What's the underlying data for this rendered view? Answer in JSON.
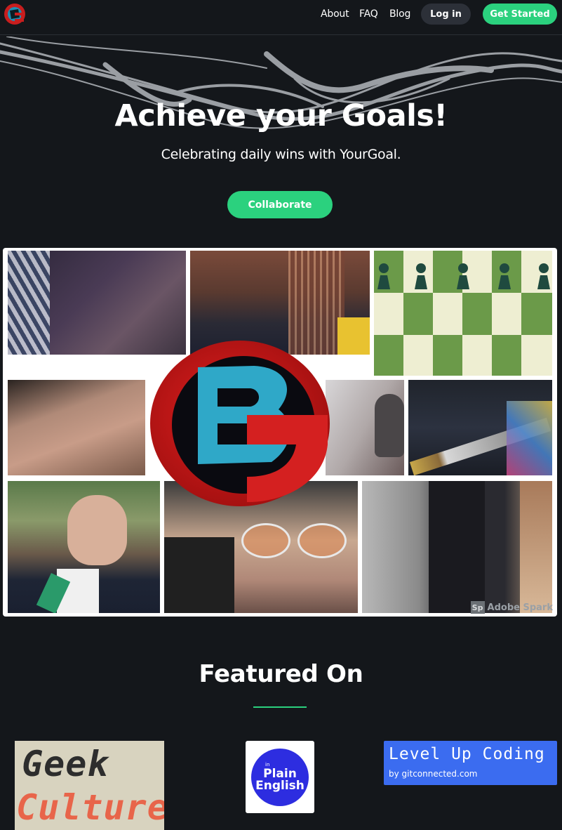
{
  "nav": {
    "links": [
      "About",
      "FAQ",
      "Blog"
    ],
    "login_label": "Log in",
    "get_started_label": "Get Started"
  },
  "hero": {
    "title": "Achieve your Goals!",
    "subtitle": "Celebrating daily wins with YourGoal.",
    "cta_label": "Collaborate"
  },
  "collage": {
    "watermark_badge": "Sp",
    "watermark_text": "Adobe Spark"
  },
  "featured": {
    "title": "Featured On",
    "publications": {
      "geek_culture": {
        "line1": "Geek",
        "line2": "Culture"
      },
      "plain_english": {
        "small": "in",
        "line1": "Plain",
        "line2": "English"
      },
      "level_up": {
        "title": "Level Up Coding",
        "subtitle": "by gitconnected.com"
      }
    }
  },
  "colors": {
    "background": "#14171b",
    "accent_green": "#2bd17e",
    "login_bg": "#2c3038",
    "level_up_blue": "#3b6cf0",
    "plain_english_blue": "#2d2de0"
  }
}
